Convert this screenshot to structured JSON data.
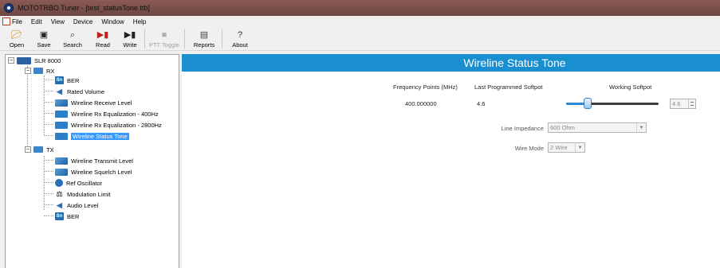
{
  "window": {
    "title": "MOTOTRBO Tuner - [test_statusTone.ttb]"
  },
  "menu": [
    "File",
    "Edit",
    "View",
    "Device",
    "Window",
    "Help"
  ],
  "toolbar": [
    {
      "label": "Open",
      "icon": "open-folder-icon",
      "enabled": true
    },
    {
      "label": "Save",
      "icon": "save-icon",
      "enabled": true
    },
    {
      "label": "Search",
      "icon": "search-icon",
      "enabled": true
    },
    {
      "label": "Read",
      "icon": "read-icon",
      "enabled": true
    },
    {
      "label": "Write",
      "icon": "write-icon",
      "enabled": true
    },
    {
      "label": "PTT Toggle",
      "icon": "ptt-icon",
      "enabled": false
    },
    {
      "label": "Reports",
      "icon": "reports-icon",
      "enabled": true
    },
    {
      "label": "About",
      "icon": "about-icon",
      "enabled": true
    }
  ],
  "tree": {
    "root": "SLR 8000",
    "rx": {
      "label": "RX",
      "items": [
        "BER",
        "Rated Volume",
        "Wireline Receive Level",
        "Wireline Rx Equalization - 400Hz",
        "Wireline Rx Equalization - 2800Hz",
        "Wireline Status Tone"
      ]
    },
    "tx": {
      "label": "TX",
      "items": [
        "Wireline Transmit Level",
        "Wireline Squelch Level",
        "Ref Oscillator",
        "Modulation Limit",
        "Audio Level",
        "BER"
      ]
    },
    "selected": "Wireline Status Tone"
  },
  "panel": {
    "title": "Wireline Status Tone",
    "columns": {
      "frequency": "Frequency Points (MHz)",
      "last_softpot": "Last Programmed Softpot",
      "working_softpot": "Working Softpot"
    },
    "row": {
      "frequency": "400.000000",
      "last_softpot": "4.6",
      "working_softpot": "4.6"
    },
    "slider_fraction": 0.22,
    "line_impedance": {
      "label": "Line Impedance",
      "value": "600 Ohm"
    },
    "wire_mode": {
      "label": "Wire Mode",
      "value": "2 Wire"
    }
  },
  "colors": {
    "accent": "#1a8fd0",
    "selection": "#3399ff",
    "titlebar": "#7d524d"
  }
}
